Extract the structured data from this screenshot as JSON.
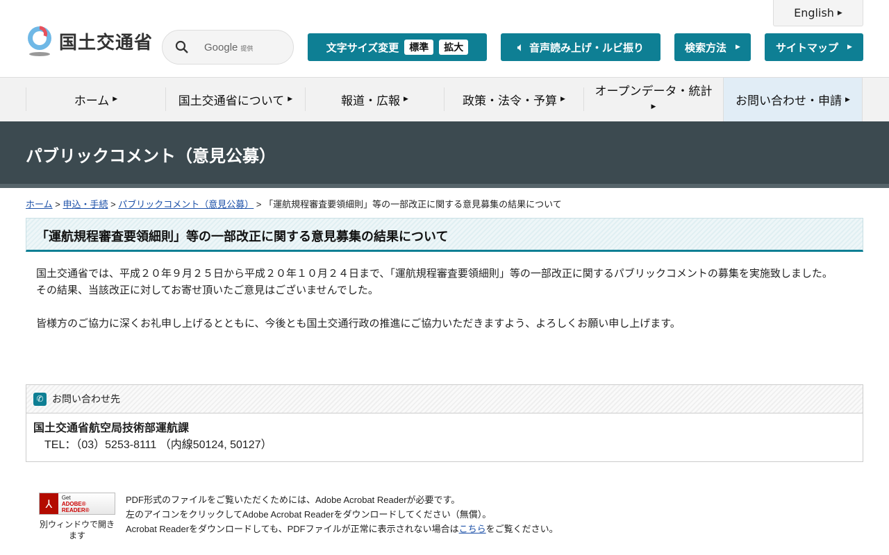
{
  "header": {
    "logo_text": "国土交通省",
    "search_brand": "Google",
    "search_provided": "提供",
    "english": "English",
    "font_size_label": "文字サイズ変更",
    "font_standard": "標準",
    "font_large": "拡大",
    "speech": "音声読み上げ・ルビ振り",
    "search_method": "検索方法",
    "sitemap": "サイトマップ"
  },
  "nav": [
    "ホーム",
    "国土交通省について",
    "報道・広報",
    "政策・法令・予算",
    "オープンデータ・統計",
    "お問い合わせ・申請"
  ],
  "banner_title": "パブリックコメント（意見公募）",
  "breadcrumb": {
    "home": "ホーム",
    "apply": "申込・手続",
    "pubcom": "パブリックコメント（意見公募）",
    "current": "「運航規程審査要領細則」等の一部改正に関する意見募集の結果について"
  },
  "title": "「運航規程審査要領細則」等の一部改正に関する意見募集の結果について",
  "body": [
    "　国土交通省では、平成２０年９月２５日から平成２０年１０月２４日まで、「運航規程審査要領細則」等の一部改正に関するパブリックコメントの募集を実施致しました。",
    "　その結果、当該改正に対してお寄せ頂いたご意見はございませんでした。",
    "　皆様方のご協力に深くお礼申し上げるとともに、今後とも国土交通行政の推進にご協力いただきますよう、よろしくお願い申し上げます。"
  ],
  "contact": {
    "heading": "お問い合わせ先",
    "org": "国土交通省航空局技術部運航課",
    "tel": "　TEL：（03）5253-8111 （内線50124, 50127）"
  },
  "pdf": {
    "badge_get": "Get",
    "badge_name": "ADOBE® READER®",
    "caption": "別ウィンドウで開きます",
    "line1": "PDF形式のファイルをご覧いただくためには、Adobe Acrobat Readerが必要です。",
    "line2": "左のアイコンをクリックしてAdobe Acrobat Readerをダウンロードしてください（無償）。",
    "line3_pre": "Acrobat Readerをダウンロードしても、PDFファイルが正常に表示されない場合は",
    "line3_link": "こちら",
    "line3_post": "をご覧ください。"
  }
}
